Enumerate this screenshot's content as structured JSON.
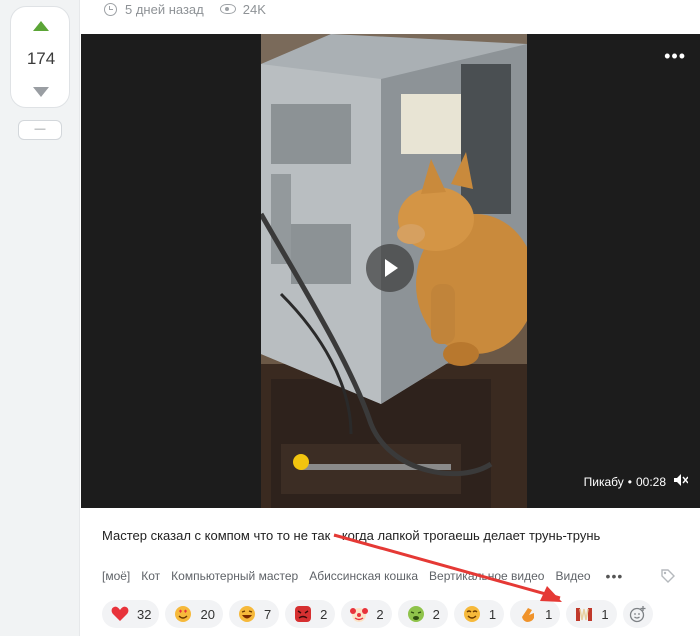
{
  "rating": {
    "score": "174",
    "minus_label": "—"
  },
  "meta": {
    "time": "5 дней назад",
    "views": "24K",
    "icons": [
      "clock-icon",
      "eye-icon"
    ]
  },
  "video": {
    "brand": "Пикабу",
    "duration": "00:28",
    "icons": [
      "more-dots-icon",
      "play-icon",
      "mute-icon"
    ]
  },
  "post": {
    "description": "Мастер сказал с компом что то не так - когда лапкой трогаешь делает трунь-трунь"
  },
  "tags": [
    "[моё]",
    "Кот",
    "Компьютерный мастер",
    "Абиссинская кошка",
    "Вертикальное видео",
    "Видео"
  ],
  "tags_more": "•••",
  "reactions": [
    {
      "emoji": "heart",
      "count": "32",
      "color": "#e8333b"
    },
    {
      "emoji": "in-love-face",
      "count": "20",
      "color": "#f6b93b"
    },
    {
      "emoji": "laughing-face",
      "count": "7",
      "color": "#f6b93b"
    },
    {
      "emoji": "angry-face",
      "count": "2",
      "color": "#d63031"
    },
    {
      "emoji": "clown-face",
      "count": "2",
      "color": "#f6b93b"
    },
    {
      "emoji": "sick-face",
      "count": "2",
      "color": "#6ab04c"
    },
    {
      "emoji": "smiling-face",
      "count": "1",
      "color": "#f6b93b"
    },
    {
      "emoji": "clap-hands",
      "count": "1",
      "color": "#f0932b"
    },
    {
      "emoji": "accordion",
      "count": "1",
      "color": "#c0392b"
    }
  ],
  "colors": {
    "accent_green": "#5ba537",
    "annotation_red": "#e53935",
    "rail_bg": "#f1f3f4"
  }
}
